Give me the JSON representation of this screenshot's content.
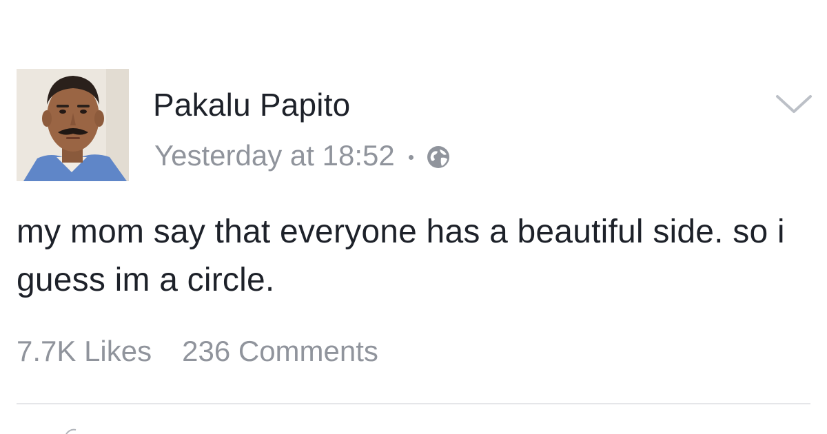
{
  "post": {
    "author": "Pakalu Papito",
    "timestamp": "Yesterday at 18:52",
    "privacy_icon": "globe-icon",
    "text": "my mom say that everyone has a beautiful side. so i guess im a circle.",
    "likes": "7.7K Likes",
    "comments": "236 Comments"
  },
  "icons": {
    "menu": "chevron-down-icon",
    "avatar": "profile-photo"
  },
  "colors": {
    "text": "#1d2129",
    "meta": "#90949c",
    "divider": "#e5e6e9",
    "background": "#ffffff"
  }
}
